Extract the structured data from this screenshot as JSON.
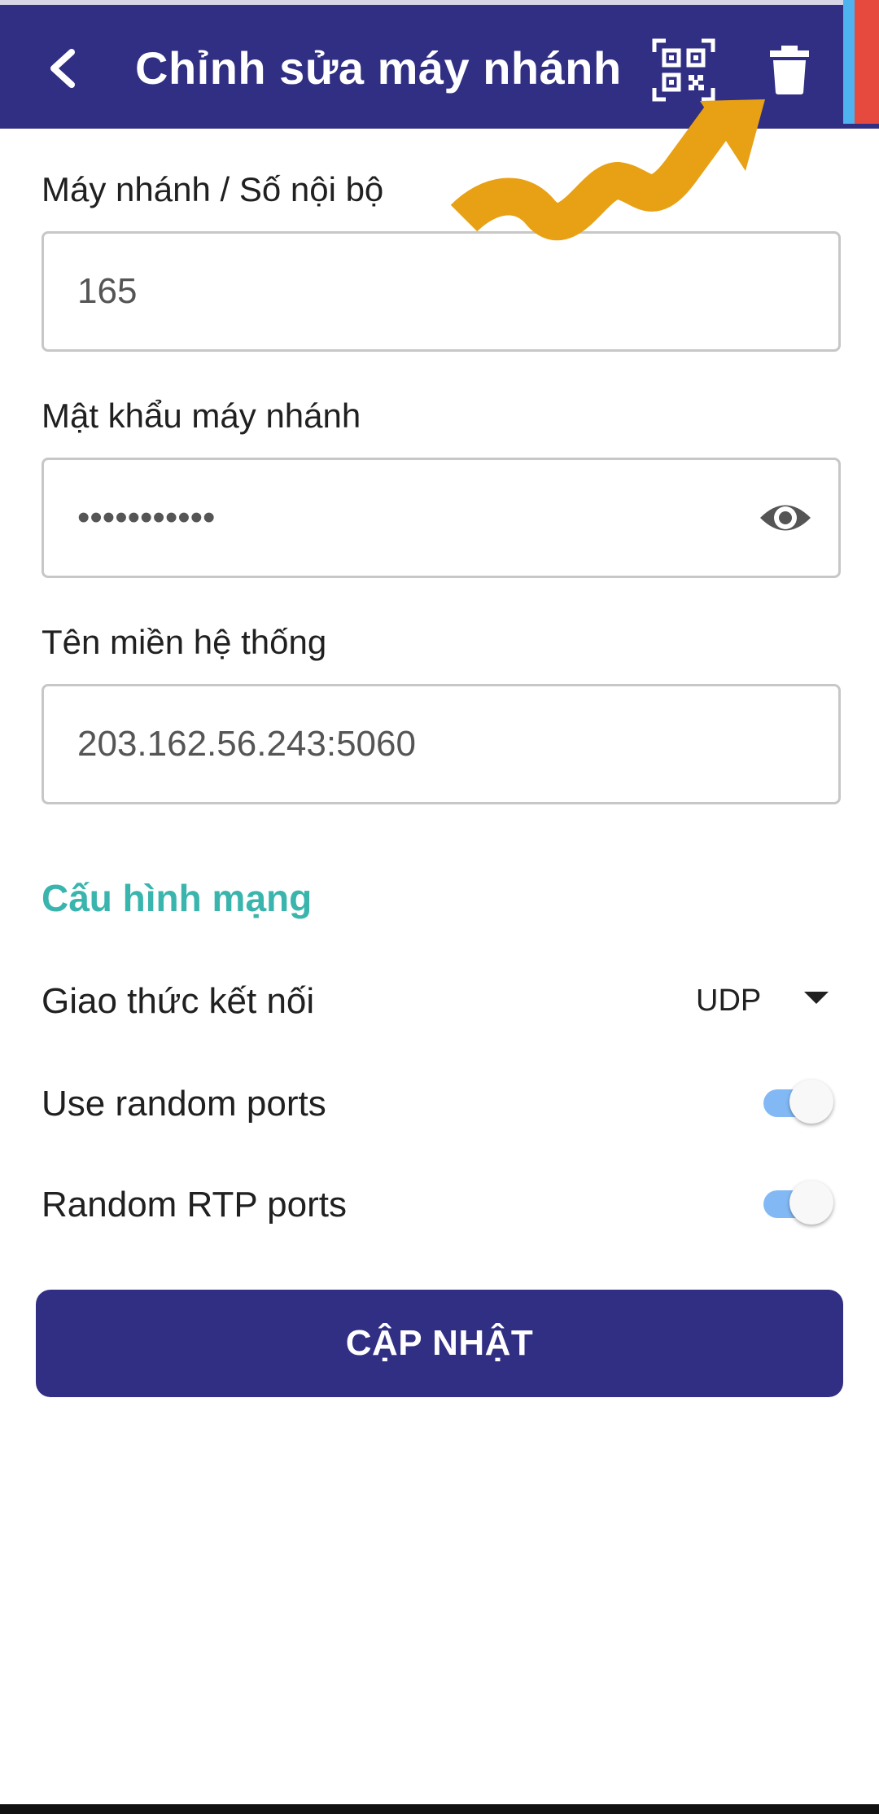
{
  "header": {
    "title": "Chỉnh sửa máy nhánh",
    "back_icon": "chevron-left-icon",
    "qr_icon": "qr-code-scan-icon",
    "delete_icon": "trash-icon"
  },
  "form": {
    "extension": {
      "label": "Máy nhánh / Số nội bộ",
      "value": "165"
    },
    "password": {
      "label": "Mật khẩu máy nhánh",
      "value": "•••••••••••",
      "toggle_icon": "eye-icon"
    },
    "domain": {
      "label": "Tên miền hệ thống",
      "value": "203.162.56.243:5060"
    }
  },
  "network": {
    "section_title": "Cấu hình mạng",
    "protocol": {
      "label": "Giao thức kết nối",
      "value": "UDP"
    },
    "random_ports": {
      "label": "Use random ports",
      "on": true
    },
    "random_rtp": {
      "label": "Random RTP ports",
      "on": true
    }
  },
  "update_button": "CẬP NHẬT",
  "colors": {
    "primary": "#302f84",
    "accent": "#3ab5ad",
    "toggle_on": "#82b9f5",
    "annotation_arrow": "#e8a115"
  }
}
